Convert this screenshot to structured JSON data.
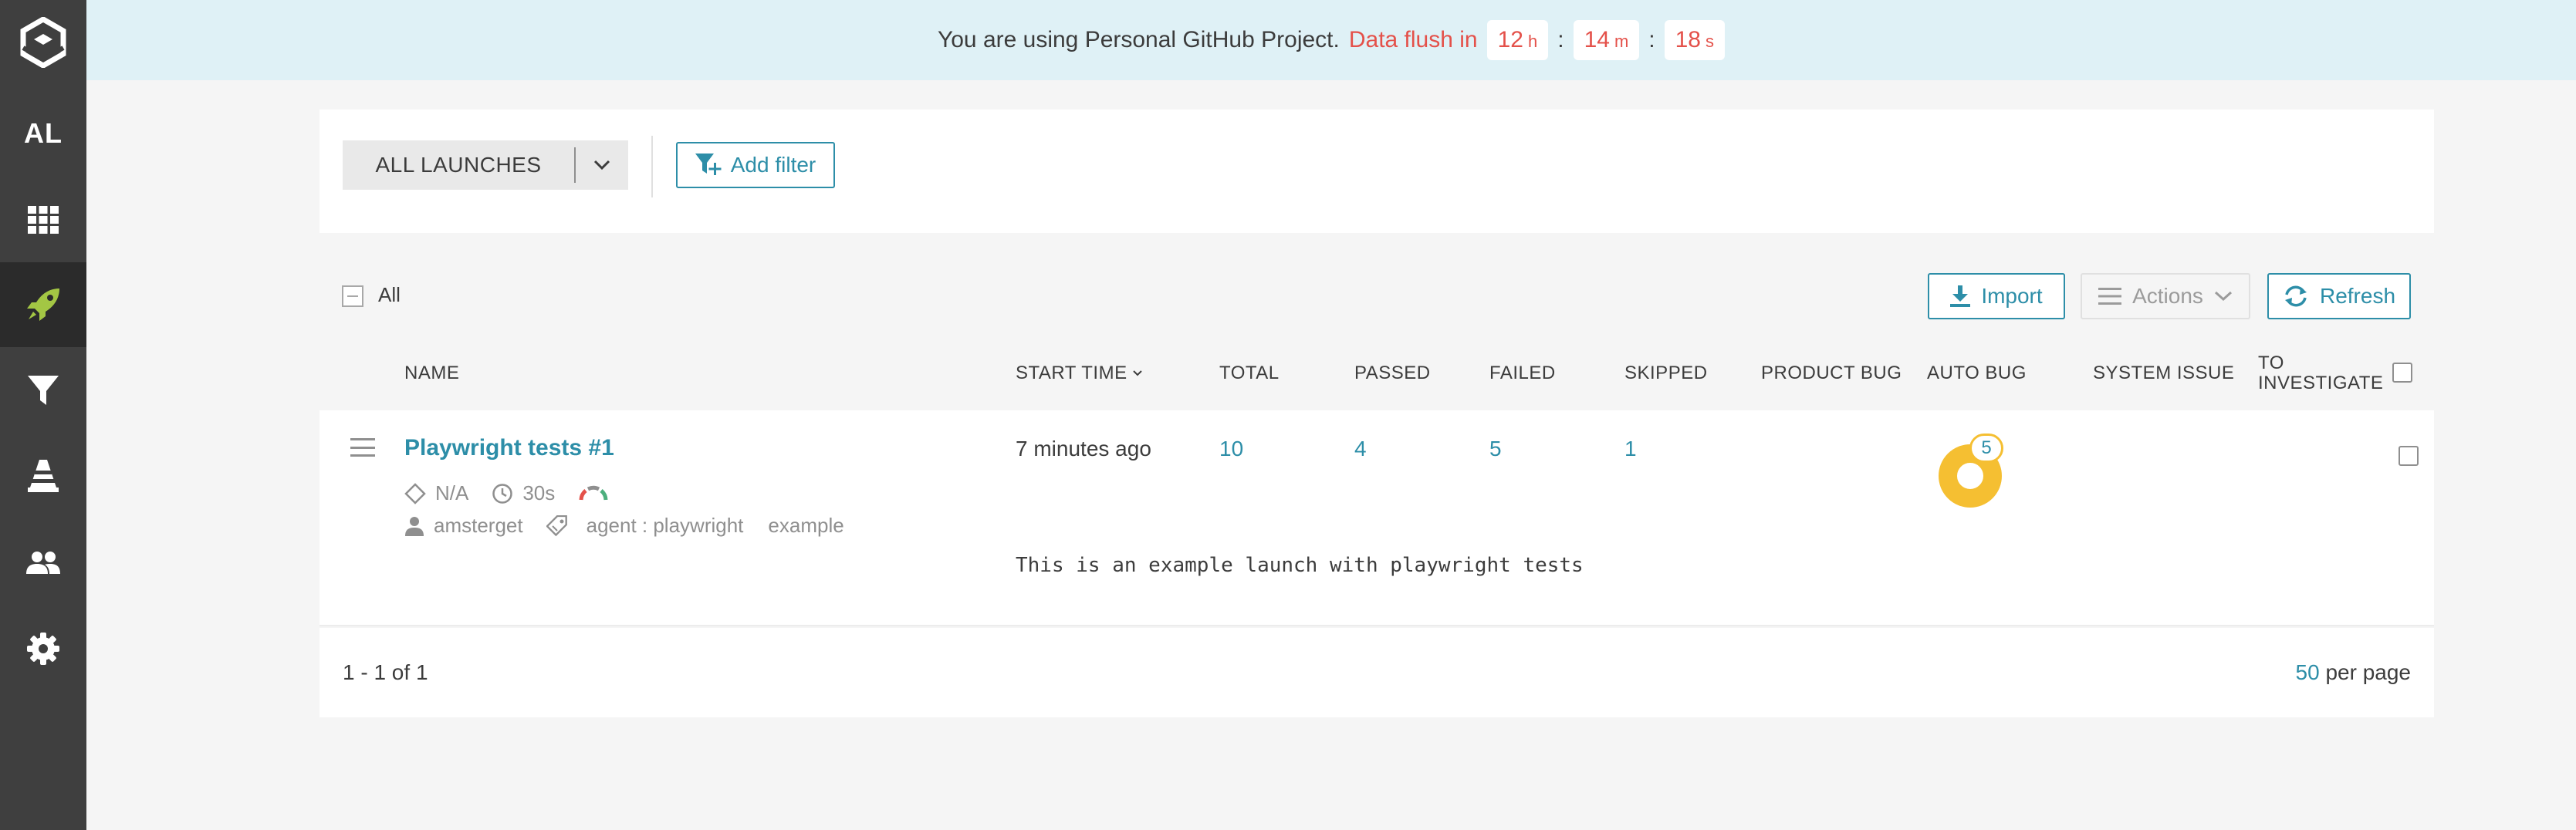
{
  "sidebar": {
    "project_initials": "AL",
    "items": [
      {
        "name": "logo",
        "icon": "reportportal-logo-icon"
      },
      {
        "name": "project",
        "icon": "project-initials"
      },
      {
        "name": "dashboards",
        "icon": "grid-icon"
      },
      {
        "name": "launches",
        "icon": "rocket-icon",
        "active": true
      },
      {
        "name": "filters",
        "icon": "filter-icon"
      },
      {
        "name": "debug",
        "icon": "cone-icon"
      },
      {
        "name": "members",
        "icon": "users-icon"
      },
      {
        "name": "settings",
        "icon": "gear-icon"
      }
    ]
  },
  "banner": {
    "message": "You are using Personal GitHub Project.",
    "flush_label": "Data flush in",
    "hours": "12",
    "hours_unit": "h",
    "minutes": "14",
    "minutes_unit": "m",
    "seconds": "18",
    "seconds_unit": "s",
    "separator": ":"
  },
  "filters": {
    "launch_select_label": "ALL LAUNCHES",
    "add_filter_label": "Add filter"
  },
  "toolbar": {
    "select_all_label": "All",
    "import_label": "Import",
    "actions_label": "Actions",
    "refresh_label": "Refresh"
  },
  "columns": {
    "name": "NAME",
    "start_time": "START TIME",
    "total": "TOTAL",
    "passed": "PASSED",
    "failed": "FAILED",
    "skipped": "SKIPPED",
    "product_bug": "PRODUCT BUG",
    "auto_bug": "AUTO BUG",
    "system_issue": "SYSTEM ISSUE",
    "to_investigate_1": "TO",
    "to_investigate_2": "INVESTIGATE"
  },
  "launch": {
    "name": "Playwright tests #1",
    "tag_na": "N/A",
    "duration": "30s",
    "owner": "amsterget",
    "attribute": "agent : playwright",
    "attribute2": "example",
    "start_time": "7 minutes ago",
    "total": "10",
    "passed": "4",
    "failed": "5",
    "skipped": "1",
    "auto_bug_count": "5",
    "description": "This is an example launch with playwright tests"
  },
  "pagination": {
    "range": "1 - 1 of 1",
    "per_page_value": "50",
    "per_page_label": "per page"
  },
  "colors": {
    "accent": "#2d8ea8",
    "banner_bg": "#dff1f6",
    "flush_red": "#e4514a",
    "auto_bug_yellow": "#f5bf32",
    "sidebar_bg": "#3f3f3f",
    "rocket_green": "#a3c644"
  }
}
